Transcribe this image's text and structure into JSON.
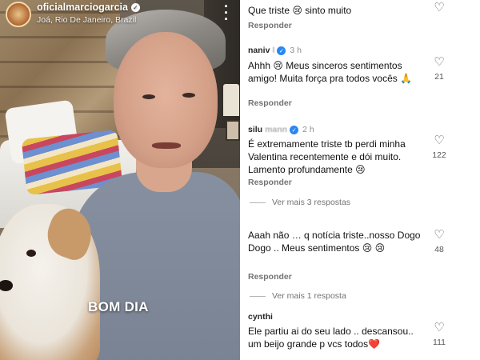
{
  "post": {
    "username": "oficialmarciogarcia",
    "location": "Joá, Rio De Janeiro, Brazil",
    "caption": "BOM DIA",
    "icons": {
      "verified": "verified-badge-icon",
      "more": "more-options-icon"
    }
  },
  "comments": [
    {
      "text": "Que triste 😢 sinto muito",
      "reply_label": "Responder"
    },
    {
      "user": "naniv",
      "user_blurred": "l",
      "time": "3 h",
      "text": "Ahhh 😢 Meus sinceros sentimentos amigo! Muita força pra todos vocês 🙏",
      "likes": "21",
      "reply_label": "Responder"
    },
    {
      "user": "silu",
      "user_blurred": "mann",
      "time": "2 h",
      "text": "É extremamente triste tb perdi minha Valentina recentemente e dói muito. Lamento profundamente 😢",
      "likes": "122",
      "reply_label": "Responder",
      "more_replies": "Ver mais 3 respostas"
    },
    {
      "text": "Aaah não … q notícia triste..nosso Dogo Dogo .. Meus sentimentos 😢 😢",
      "likes": "48",
      "reply_label": "Responder",
      "more_replies": "Ver mais 1 resposta"
    },
    {
      "user": "cynthi",
      "text": "Ele partiu ai do seu lado .. descansou.. um beijo grande p vcs todos❤️",
      "likes": "111"
    }
  ],
  "colors": {
    "verified_blue": "#2a86f0",
    "muted_text": "#737373",
    "heart": "#e0245e"
  },
  "icons": {
    "like": "heart-outline-icon"
  }
}
